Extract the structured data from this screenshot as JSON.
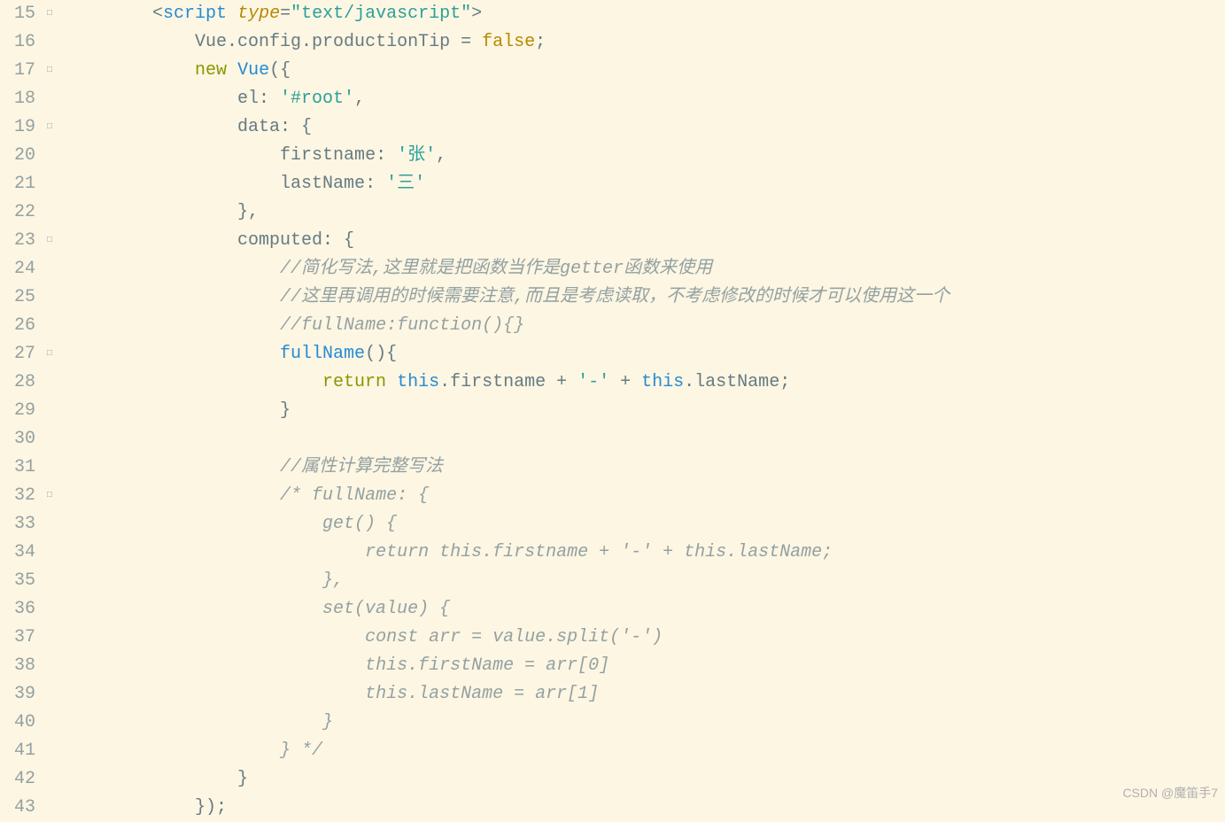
{
  "lineStart": 15,
  "lines": [
    {
      "fold": "□",
      "indent": 2,
      "tokens": [
        {
          "c": "t-angle",
          "t": "<"
        },
        {
          "c": "t-tag",
          "t": "script"
        },
        {
          "c": "",
          "t": " "
        },
        {
          "c": "t-attr",
          "t": "type"
        },
        {
          "c": "t-punct",
          "t": "="
        },
        {
          "c": "t-string",
          "t": "\"text/javascript\""
        },
        {
          "c": "t-angle",
          "t": ">"
        }
      ]
    },
    {
      "fold": "",
      "indent": 3,
      "tokens": [
        {
          "c": "t-prop",
          "t": "Vue.config.productionTip = "
        },
        {
          "c": "t-bool",
          "t": "false"
        },
        {
          "c": "t-punct",
          "t": ";"
        }
      ]
    },
    {
      "fold": "□",
      "indent": 3,
      "tokens": [
        {
          "c": "t-keyword2",
          "t": "new"
        },
        {
          "c": "",
          "t": " "
        },
        {
          "c": "t-func",
          "t": "Vue"
        },
        {
          "c": "t-punct",
          "t": "({"
        }
      ]
    },
    {
      "fold": "",
      "indent": 4,
      "tokens": [
        {
          "c": "t-prop",
          "t": "el: "
        },
        {
          "c": "t-string",
          "t": "'#root'"
        },
        {
          "c": "t-punct",
          "t": ","
        }
      ]
    },
    {
      "fold": "□",
      "indent": 4,
      "tokens": [
        {
          "c": "t-prop",
          "t": "data: {"
        }
      ]
    },
    {
      "fold": "",
      "indent": 5,
      "tokens": [
        {
          "c": "t-prop",
          "t": "firstname: "
        },
        {
          "c": "t-string",
          "t": "'张'"
        },
        {
          "c": "t-punct",
          "t": ","
        }
      ]
    },
    {
      "fold": "",
      "indent": 5,
      "tokens": [
        {
          "c": "t-prop",
          "t": "lastName: "
        },
        {
          "c": "t-string",
          "t": "'三'"
        }
      ]
    },
    {
      "fold": "",
      "indent": 4,
      "tokens": [
        {
          "c": "t-punct",
          "t": "},"
        }
      ]
    },
    {
      "fold": "□",
      "indent": 4,
      "tokens": [
        {
          "c": "t-prop",
          "t": "computed: {"
        }
      ]
    },
    {
      "fold": "",
      "indent": 5,
      "tokens": [
        {
          "c": "t-comment",
          "t": "//简化写法,这里就是把函数当作是getter函数来使用"
        }
      ]
    },
    {
      "fold": "",
      "indent": 5,
      "tokens": [
        {
          "c": "t-comment",
          "t": "//这里再调用的时候需要注意,而且是考虑读取，不考虑修改的时候才可以使用这一个"
        }
      ]
    },
    {
      "fold": "",
      "indent": 5,
      "tokens": [
        {
          "c": "t-comment",
          "t": "//fullName:function(){}"
        }
      ]
    },
    {
      "fold": "□",
      "indent": 5,
      "tokens": [
        {
          "c": "t-func",
          "t": "fullName"
        },
        {
          "c": "t-punct",
          "t": "(){"
        }
      ]
    },
    {
      "fold": "",
      "indent": 6,
      "tokens": [
        {
          "c": "t-kwreturn",
          "t": "return"
        },
        {
          "c": "",
          "t": " "
        },
        {
          "c": "t-this",
          "t": "this"
        },
        {
          "c": "t-prop",
          "t": ".firstname + "
        },
        {
          "c": "t-string",
          "t": "'-'"
        },
        {
          "c": "t-prop",
          "t": " + "
        },
        {
          "c": "t-this",
          "t": "this"
        },
        {
          "c": "t-prop",
          "t": ".lastName;"
        }
      ]
    },
    {
      "fold": "",
      "indent": 5,
      "tokens": [
        {
          "c": "t-punct",
          "t": "}"
        }
      ]
    },
    {
      "fold": "",
      "indent": 0,
      "tokens": []
    },
    {
      "fold": "",
      "indent": 5,
      "tokens": [
        {
          "c": "t-comment",
          "t": "//属性计算完整写法"
        }
      ]
    },
    {
      "fold": "□",
      "indent": 5,
      "tokens": [
        {
          "c": "t-comment",
          "t": "/* fullName: {"
        }
      ]
    },
    {
      "fold": "",
      "indent": 6,
      "tokens": [
        {
          "c": "t-comment",
          "t": "get() {"
        }
      ]
    },
    {
      "fold": "",
      "indent": 7,
      "tokens": [
        {
          "c": "t-comment",
          "t": "return this.firstname + '-' + this.lastName;"
        }
      ]
    },
    {
      "fold": "",
      "indent": 6,
      "tokens": [
        {
          "c": "t-comment",
          "t": "},"
        }
      ]
    },
    {
      "fold": "",
      "indent": 6,
      "tokens": [
        {
          "c": "t-comment",
          "t": "set(value) {"
        }
      ]
    },
    {
      "fold": "",
      "indent": 7,
      "tokens": [
        {
          "c": "t-comment",
          "t": "const arr = value.split('-')"
        }
      ]
    },
    {
      "fold": "",
      "indent": 7,
      "tokens": [
        {
          "c": "t-comment",
          "t": "this.firstName = arr[0]"
        }
      ]
    },
    {
      "fold": "",
      "indent": 7,
      "tokens": [
        {
          "c": "t-comment",
          "t": "this.lastName = arr[1]"
        }
      ]
    },
    {
      "fold": "",
      "indent": 6,
      "tokens": [
        {
          "c": "t-comment",
          "t": "}"
        }
      ]
    },
    {
      "fold": "",
      "indent": 5,
      "tokens": [
        {
          "c": "t-comment",
          "t": "} */"
        }
      ]
    },
    {
      "fold": "",
      "indent": 4,
      "tokens": [
        {
          "c": "t-punct",
          "t": "}"
        }
      ]
    },
    {
      "fold": "",
      "indent": 3,
      "tokens": [
        {
          "c": "t-punct",
          "t": "});"
        }
      ]
    }
  ],
  "watermark": "CSDN @魔笛手7"
}
